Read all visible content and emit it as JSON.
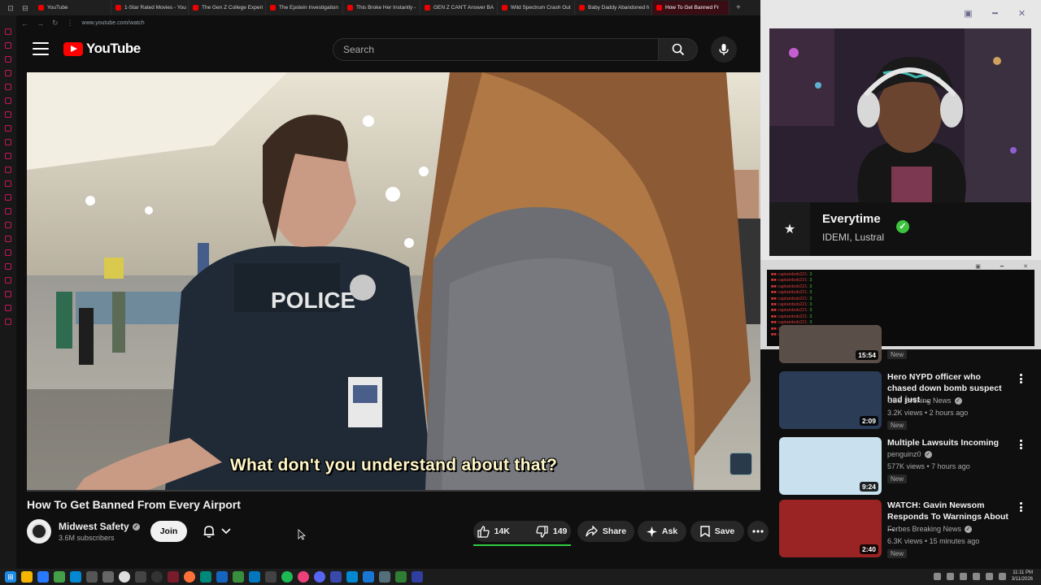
{
  "browser": {
    "tabs": [
      {
        "label": "YouTube"
      },
      {
        "label": "1-Star Rated Movies - You"
      },
      {
        "label": "The Gen Z College Experi"
      },
      {
        "label": "The Epstein Investigation"
      },
      {
        "label": "This Broke Her Instantly -"
      },
      {
        "label": "GEN Z CAN'T Answer BA"
      },
      {
        "label": "Wild Spectrum Crash Out"
      },
      {
        "label": "Baby Daddy Abandoned h"
      },
      {
        "label": "How To Get Banned Fr"
      }
    ],
    "url": "www.youtube.com/watch"
  },
  "youtube": {
    "logo_text": "YouTube",
    "search_placeholder": "Search"
  },
  "video": {
    "caption": "What don't you understand about that?",
    "badge_text": "POLICE",
    "progress_fraction": 0.0,
    "title": "How To Get Banned From Every Airport",
    "channel": "Midwest Safety",
    "subscribers": "3.6M subscribers",
    "join_label": "Join",
    "likes": "14K",
    "dislikes": "149",
    "share_label": "Share",
    "ask_label": "Ask",
    "save_label": "Save"
  },
  "overlay": {
    "song_title": "Everytime",
    "song_artist": "IDEMI, Lustral",
    "chat_lines": [
      {
        "user": "captainbob221:",
        "msg": "3"
      },
      {
        "user": "captainbob221:",
        "msg": "3"
      },
      {
        "user": "captainbob221:",
        "msg": "3"
      },
      {
        "user": "captainbob221:",
        "msg": "3"
      },
      {
        "user": "captainbob221:",
        "msg": "3"
      },
      {
        "user": "captainbob221:",
        "msg": "3"
      },
      {
        "user": "captainbob221:",
        "msg": "3"
      },
      {
        "user": "captainbob221:",
        "msg": "3"
      },
      {
        "user": "captainbob221:",
        "msg": "3"
      },
      {
        "user": "captainbob221:",
        "msg": "3"
      },
      {
        "user": "captainbob221:",
        "msg": "3"
      }
    ]
  },
  "recommended": {
    "partial": {
      "duration": "15:54",
      "badge": "New"
    },
    "items": [
      {
        "title": "Hero NYPD officer who chased down bomb suspect had just ...",
        "channel": "CBS Evening News",
        "meta": "3.2K views • 2 hours ago",
        "duration": "2:09",
        "badge": "New",
        "thumb_color": "#2b3c56"
      },
      {
        "title": "Multiple Lawsuits Incoming",
        "channel": "penguinz0",
        "meta": "577K views • 7 hours ago",
        "duration": "9:24",
        "badge": "New",
        "thumb_color": "#c9e0ee"
      },
      {
        "title": "WATCH: Gavin Newsom Responds To Warnings About ...",
        "channel": "Forbes Breaking News",
        "meta": "6.3K views • 15 minutes ago",
        "duration": "2:40",
        "badge": "New",
        "thumb_color": "#9a2424"
      }
    ]
  },
  "taskbar": {
    "time": "11:11 PM",
    "date": "3/11/2026"
  },
  "colors": {
    "youtube_red": "#ff0000",
    "like_underline": "#2ecc40",
    "verified_check": "#3ec33e"
  }
}
